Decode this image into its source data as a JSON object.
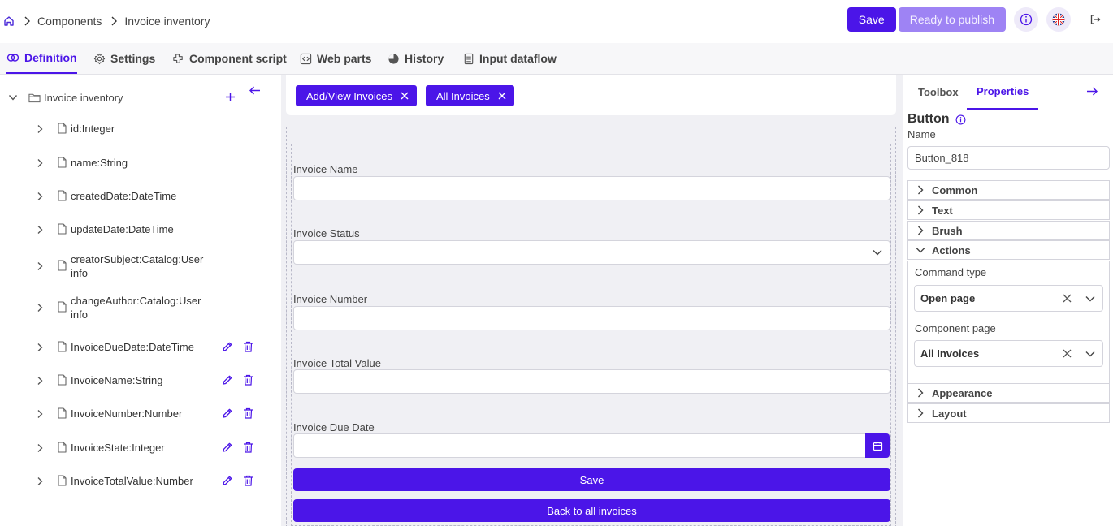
{
  "breadcrumb": {
    "items": [
      "Components",
      "Invoice inventory"
    ]
  },
  "topbar": {
    "save_label": "Save",
    "ready_label": "Ready to publish"
  },
  "tabs": [
    {
      "label": "Definition"
    },
    {
      "label": "Settings"
    },
    {
      "label": "Component script"
    },
    {
      "label": "Web parts"
    },
    {
      "label": "History"
    },
    {
      "label": "Input dataflow"
    }
  ],
  "tree": {
    "root": "Invoice inventory",
    "items": [
      {
        "label": "id:Integer"
      },
      {
        "label": "name:String"
      },
      {
        "label": "createdDate:DateTime"
      },
      {
        "label": "updateDate:DateTime"
      },
      {
        "label": "creatorSubject:Catalog:User info"
      },
      {
        "label": "changeAuthor:Catalog:User info"
      },
      {
        "label": "InvoiceDueDate:DateTime"
      },
      {
        "label": "InvoiceName:String"
      },
      {
        "label": "InvoiceNumber:Number"
      },
      {
        "label": "InvoiceState:Integer"
      },
      {
        "label": "InvoiceTotalValue:Number"
      }
    ]
  },
  "canvas": {
    "page_tabs": [
      {
        "label": "Add/View Invoices"
      },
      {
        "label": "All Invoices"
      }
    ],
    "fields": [
      {
        "label": "Invoice Name"
      },
      {
        "label": "Invoice Status"
      },
      {
        "label": "Invoice Number"
      },
      {
        "label": "Invoice Total Value"
      },
      {
        "label": "Invoice Due Date"
      }
    ],
    "save_label": "Save",
    "back_label": "Back to all invoices"
  },
  "properties": {
    "tabs": [
      "Toolbox",
      "Properties"
    ],
    "title": "Button",
    "name_label": "Name",
    "name_value": "Button_818",
    "sections": [
      "Common",
      "Text",
      "Brush",
      "Actions",
      "Appearance",
      "Layout"
    ],
    "command_type_label": "Command type",
    "command_type_value": "Open page",
    "component_page_label": "Component page",
    "component_page_value": "All Invoices"
  },
  "colors": {
    "accent": "#4b15e8",
    "accent_light": "#9e83f4"
  }
}
